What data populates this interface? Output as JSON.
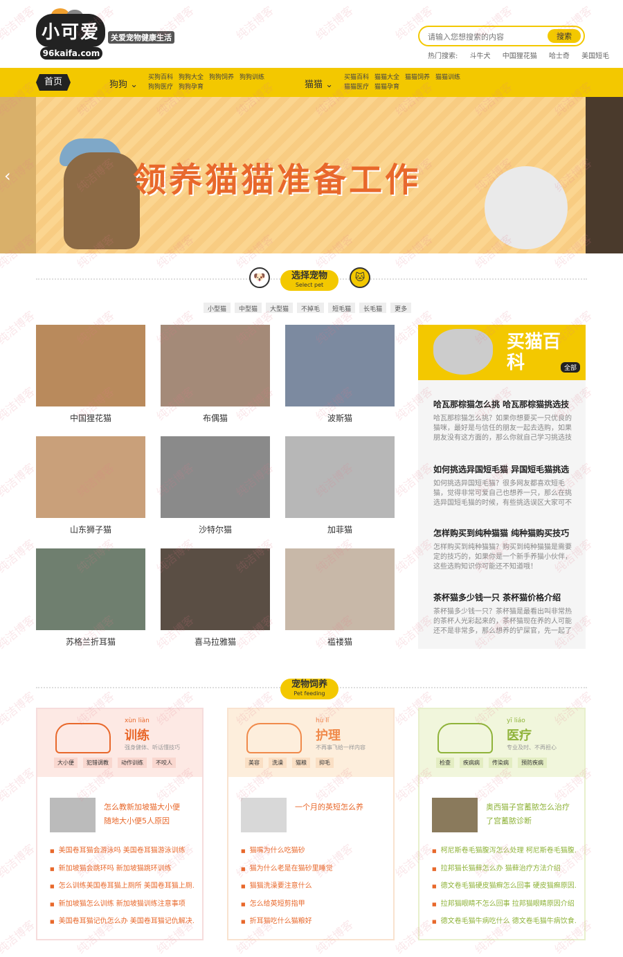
{
  "header": {
    "logo_text": "小可爱",
    "logo_domain": "96kaifa.com",
    "slogan": "关爱宠物健康生活",
    "search_placeholder": "请输入您想搜索的内容",
    "search_button": "搜索",
    "hot_label": "热门搜索:",
    "hot_items": [
      "斗牛犬",
      "中国狸花猫",
      "哈士奇",
      "美国短毛"
    ]
  },
  "nav": {
    "home": "首页",
    "dog_label": "狗狗",
    "dog_links": [
      "买狗百科",
      "狗狗大全",
      "狗狗饲养",
      "狗狗训练",
      "狗狗医疗",
      "狗狗孕育"
    ],
    "cat_label": "猫猫",
    "cat_links": [
      "买猫百科",
      "猫猫大全",
      "猫猫饲养",
      "猫猫训练",
      "猫猫医疗",
      "猫猫孕育"
    ]
  },
  "banner": {
    "title": "领养猫猫准备工作"
  },
  "select_section": {
    "left_icon_label": "狗狗",
    "title": "选择宠物",
    "subtitle": "Select pet",
    "right_icon_label": "猫猫",
    "tags": [
      "小型猫",
      "中型猫",
      "大型猫",
      "不掉毛",
      "短毛猫",
      "长毛猫",
      "更多"
    ]
  },
  "cats": [
    {
      "name": "中国狸花猫",
      "color": "#b98a5c"
    },
    {
      "name": "布偶猫",
      "color": "#a48a78"
    },
    {
      "name": "波斯猫",
      "color": "#7c8aa0"
    },
    {
      "name": "山东狮子猫",
      "color": "#c9a07a"
    },
    {
      "name": "沙特尔猫",
      "color": "#8a8a8a"
    },
    {
      "name": "加菲猫",
      "color": "#b7b7b7"
    },
    {
      "name": "苏格兰折耳猫",
      "color": "#6f7f6f"
    },
    {
      "name": "喜马拉雅猫",
      "color": "#5a4e44"
    },
    {
      "name": "褴褛猫",
      "color": "#c8b8a8"
    }
  ],
  "sidebar": {
    "header_text": "买猫百科",
    "all_label": "全部",
    "articles": [
      {
        "title": "哈瓦那棕猫怎么挑 哈瓦那棕猫挑选技",
        "desc": "哈瓦那棕猫怎么挑？如果你想要买一只优良的猫咪，最好是与信任的朋友一起去选购，如果朋友没有这方面的，那么你就自己学习挑选技巧啦！"
      },
      {
        "title": "如何挑选异国短毛猫 异国短毛猫挑选",
        "desc": "如何挑选异国短毛猫？很多网友都喜欢短毛猫，觉得非常可爱自己也想养一只，那么在挑选异国短毛猫的时候，有些挑选误区大家可不要犯的~"
      },
      {
        "title": "怎样购买到纯种猫猫 纯种猫购买技巧",
        "desc": "怎样购买到纯种猫猫？购买到纯种猫猫是需要定的技巧的，如果你是一个新手养猫小伙伴，这些选购知识你可能还不知道哦！"
      },
      {
        "title": "茶杯猫多少钱一只 茶杯猫价格介绍",
        "desc": "茶杯猫多少钱一只？茶杯猫是最看出叫非常热的茶杯人光彩起来的，茶杯猫现在养的人可能还不是非常多，那么想养的铲屎官，先一起了解下价"
      }
    ]
  },
  "feed_section": {
    "title": "宠物饲养",
    "subtitle": "Pet feeding"
  },
  "boxes": [
    {
      "pinyin": "xùn liàn",
      "title": "训练",
      "sub": "强身健体、听话懂技巧",
      "tags": [
        "大小便",
        "犯错调教",
        "动作训练",
        "不咬人"
      ],
      "feature": "怎么教新加坡猫大小便 随地大小便5人原因",
      "list": [
        "美国卷耳猫会游泳吗 美国卷耳猫游泳训练",
        "新加坡猫会跳环吗 新加坡猫跳环训练",
        "怎么训练美国卷耳猫上厕所 美国卷耳猫上厕...",
        "新加坡猫怎么训练 新加坡猫训练注意事项",
        "美国卷耳猫记仇怎么办 美国卷耳猫记仇解决..."
      ]
    },
    {
      "pinyin": "hù lǐ",
      "title": "护理",
      "sub": "不再事飞给一样内容",
      "tags": [
        "美容",
        "洗澡",
        "猫粮",
        "抑毛"
      ],
      "feature": "一个月的英短怎么养",
      "list": [
        "猫嘴为什么吃猫砂",
        "猫为什么老是在猫砂里睡觉",
        "猫猫洗澡要注意什么",
        "怎么给英短剪指甲",
        "折耳猫吃什么猫粮好"
      ]
    },
    {
      "pinyin": "yī liáo",
      "title": "医疗",
      "sub": "专业及时、不再担心",
      "tags": [
        "检查",
        "疾病病",
        "传染病",
        "预防疾病"
      ],
      "feature": "奥西猫子宫蓄脓怎么治疗 了宫蓄脓诊断",
      "list": [
        "柯尼斯卷毛猫腹泻怎么处理 柯尼斯卷毛猫腹...",
        "拉邦猫长猫藓怎么办 猫藓治疗方法介绍",
        "德文卷毛猫硬皮猫癣怎么回事 硬皮猫癣原因...",
        "拉邦猫眼睛不怎么回事 拉邦猫眼睛原因介绍",
        "德文卷毛猫牛病吃什么 德文卷毛猫牛病饮食..."
      ]
    }
  ],
  "watermark": "纯洁博客"
}
